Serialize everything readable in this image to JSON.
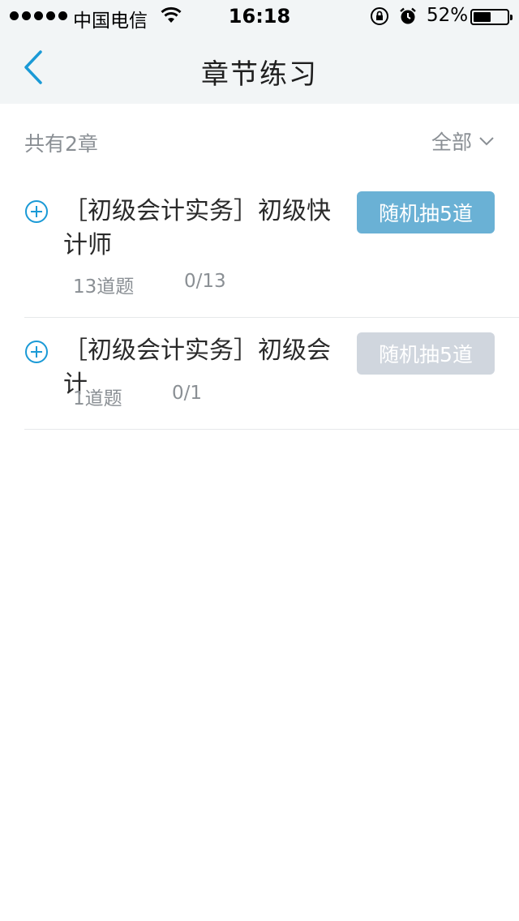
{
  "status_bar": {
    "carrier": "中国电信",
    "time": "16:18",
    "battery_percent": "52%",
    "battery_level": 0.52
  },
  "nav": {
    "title": "章节练习"
  },
  "summary": {
    "count_text": "共有2章",
    "filter_label": "全部"
  },
  "chapters": [
    {
      "name": "［初级会计实务］初级快计师",
      "question_count": "13道题",
      "progress": "0/13",
      "button_label": "随机抽5道",
      "button_enabled": true
    },
    {
      "name": "［初级会计实务］初级会计",
      "question_count": "1道题",
      "progress": "0/1",
      "button_label": "随机抽5道",
      "button_enabled": false
    }
  ],
  "colors": {
    "accent": "#1a9ad6",
    "button_active": "#6ab1d5",
    "button_disabled": "#d0d6de",
    "header_bg": "#f2f5f6"
  }
}
